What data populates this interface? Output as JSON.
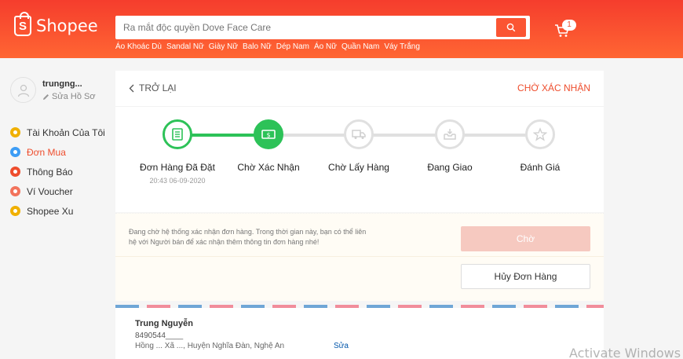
{
  "header": {
    "logo_text": "Shopee",
    "search_placeholder": "Ra mắt độc quyền Dove Face Care",
    "suggestions": [
      "Áo Khoác Dù",
      "Sandal Nữ",
      "Giày Nữ",
      "Balo Nữ",
      "Dép Nam",
      "Áo Nữ",
      "Quần Nam",
      "Váy Trắng"
    ],
    "cart_count": "1"
  },
  "sidebar": {
    "username": "trungng...",
    "edit_profile": "Sửa Hồ Sơ",
    "items": [
      {
        "label": "Tài Khoản Của Tôi",
        "color": "#f0b000"
      },
      {
        "label": "Đơn Mua",
        "color": "#3d9df5"
      },
      {
        "label": "Thông Báo",
        "color": "#ee4d2d"
      },
      {
        "label": "Ví Voucher",
        "color": "#f2735c"
      },
      {
        "label": "Shopee Xu",
        "color": "#f0b000"
      }
    ]
  },
  "order": {
    "back_label": "TRỞ LẠI",
    "status": "CHỜ XÁC NHẬN",
    "steps": [
      {
        "label": "Đơn Hàng Đã Đặt",
        "date": "20:43 06-09-2020",
        "state": "done",
        "icon": "receipt-icon"
      },
      {
        "label": "Chờ Xác Nhận",
        "date": "",
        "state": "current",
        "icon": "money-icon"
      },
      {
        "label": "Chờ Lấy Hàng",
        "date": "",
        "state": "pending",
        "icon": "truck-icon"
      },
      {
        "label": "Đang Giao",
        "date": "",
        "state": "pending",
        "icon": "box-icon"
      },
      {
        "label": "Đánh Giá",
        "date": "",
        "state": "pending",
        "icon": "star-icon"
      }
    ]
  },
  "info": {
    "message": "Đang chờ hệ thống xác nhận đơn hàng. Trong thời gian này, bạn có thể liên hệ với Người bán để xác nhận thêm thông tin đơn hàng nhé!",
    "wait_button": "Chờ",
    "cancel_button": "Hủy Đơn Hàng"
  },
  "address": {
    "name": "Trung Nguyễn",
    "phone": "8490544____",
    "line": "Hồng ... Xã ..., Huyện Nghĩa Đàn, Nghệ An",
    "edit": "Sửa"
  },
  "watermark": "Activate Windows",
  "colors": {
    "brand": "#ee4d2d",
    "success": "#2dc258"
  }
}
